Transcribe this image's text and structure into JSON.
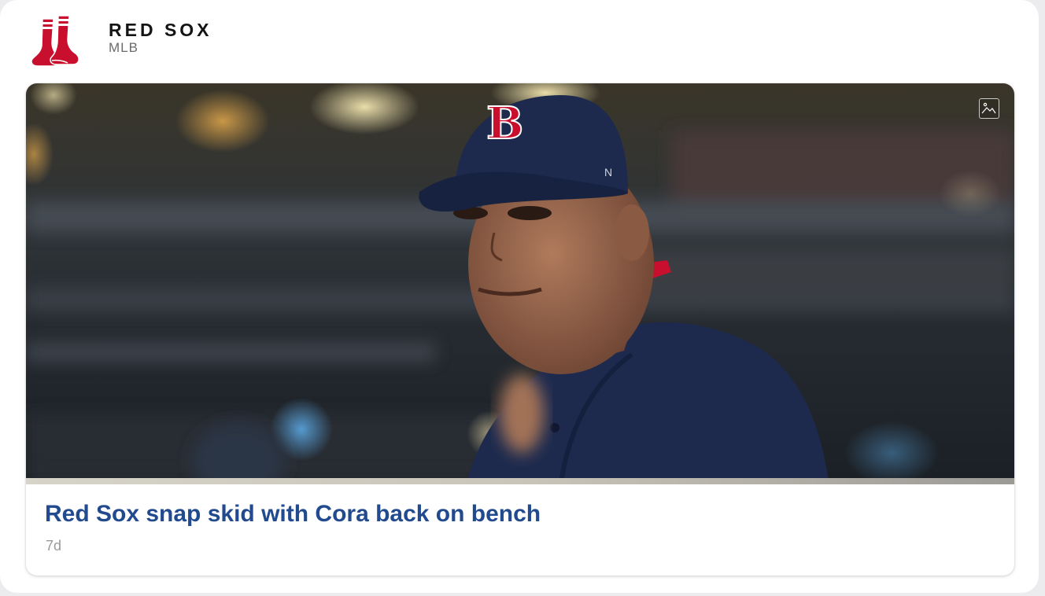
{
  "team": {
    "name": "RED SOX",
    "league": "MLB",
    "logo_icon": "red-sox-logo"
  },
  "story": {
    "headline": "Red Sox snap skid with Cora back on bench",
    "age": "7d",
    "photo_icon": "gallery-icon",
    "photo_description_icon": "team-manager-photo"
  },
  "colors": {
    "headline": "#214a8f",
    "team_red": "#c8102e",
    "navy": "#1d2a4e"
  }
}
